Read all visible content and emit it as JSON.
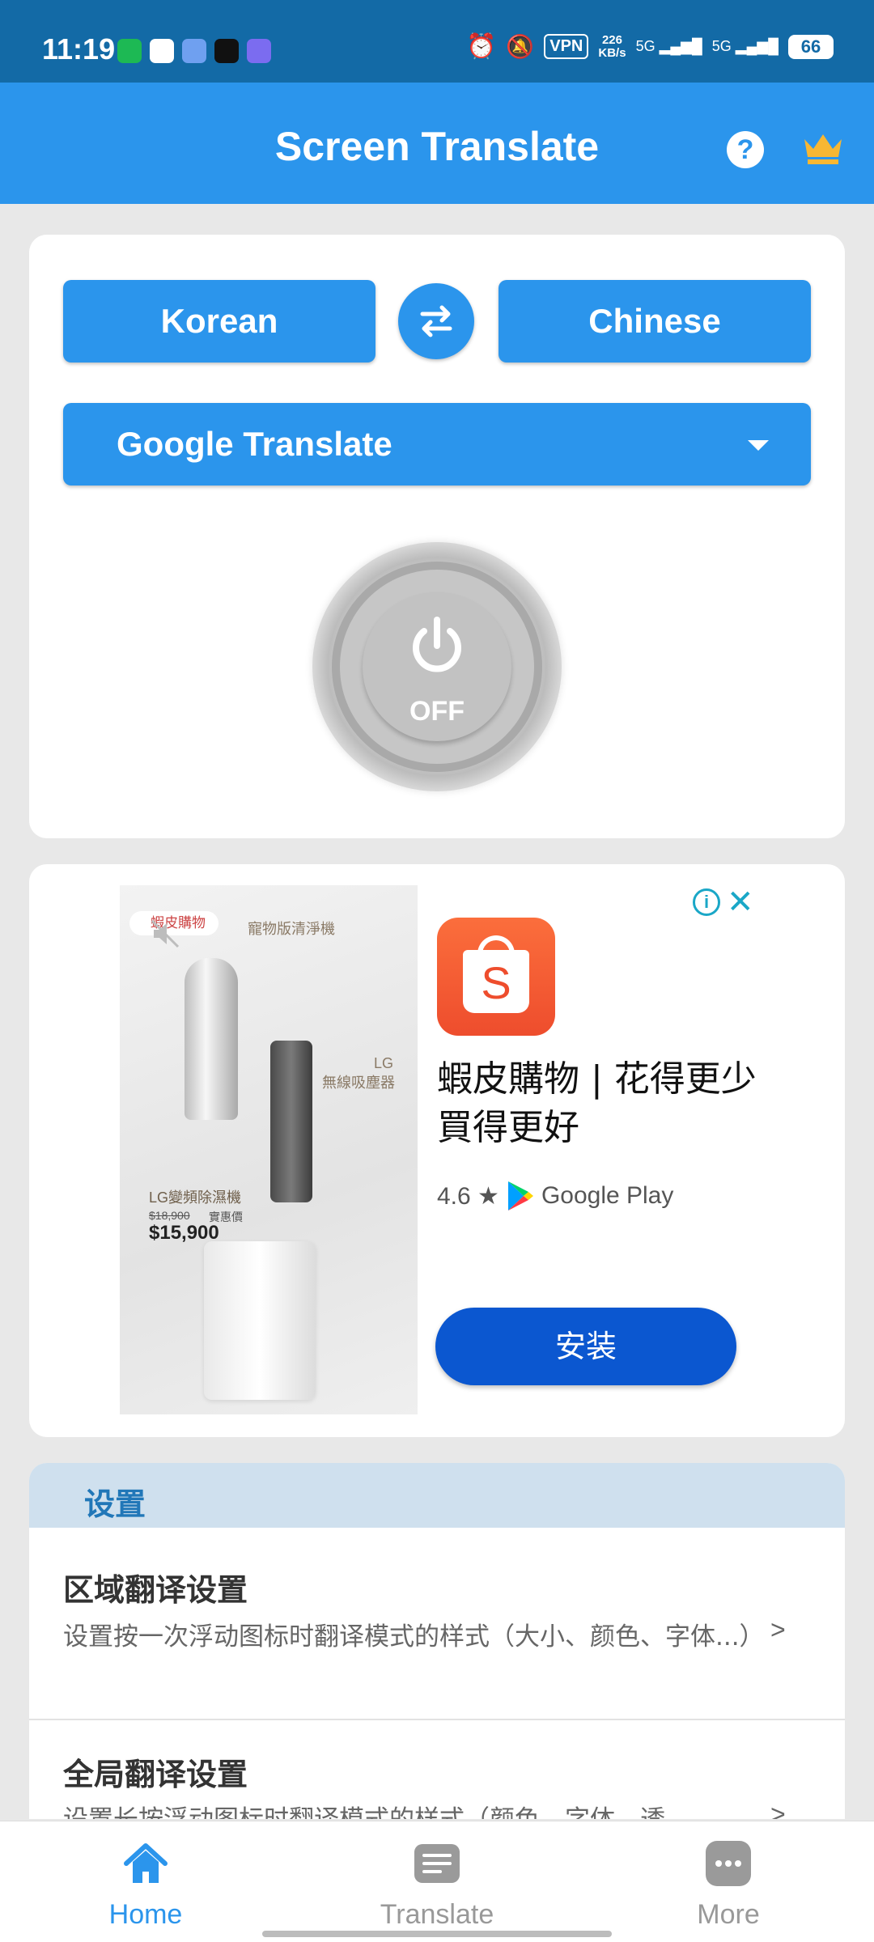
{
  "status_bar": {
    "time": "11:19",
    "vpn": "VPN",
    "net_speed_value": "226",
    "net_speed_unit": "KB/s",
    "signal_1": "5G",
    "signal_2": "5G",
    "battery": "66"
  },
  "app_bar": {
    "title": "Screen Translate",
    "help_glyph": "?"
  },
  "translator": {
    "source_language": "Korean",
    "target_language": "Chinese",
    "engine": "Google Translate",
    "power_state": "OFF"
  },
  "ad": {
    "image_badge": "蝦皮購物",
    "image_text_1": "寵物版清淨機",
    "image_text_2": "LG",
    "image_text_3": "無線吸塵器",
    "image_text_4": "LG變頻除濕機",
    "image_price_old": "$18,900",
    "image_price_label": "實惠價",
    "image_price": "$15,900",
    "logo_letter": "S",
    "title": "蝦皮購物 | 花得更少買得更好",
    "rating": "4.6 ★",
    "store_name": "Google Play",
    "install_label": "安装",
    "info_glyph": "i",
    "close_glyph": "✕"
  },
  "settings": {
    "header": "设置",
    "items": [
      {
        "title": "区域翻译设置",
        "description": "设置按一次浮动图标时翻译模式的样式（大小、颜色、字体...）",
        "chevron": ">"
      },
      {
        "title": "全局翻译设置",
        "description": "设置长按浮动图标时翻译模式的样式（颜色、字体、透",
        "chevron": ">"
      }
    ]
  },
  "bottom_nav": {
    "items": [
      {
        "label": "Home",
        "icon": "home-icon",
        "active": true
      },
      {
        "label": "Translate",
        "icon": "list-icon",
        "active": false
      },
      {
        "label": "More",
        "icon": "more-icon",
        "active": false
      }
    ]
  },
  "colors": {
    "status_bar": "#136aa6",
    "app_bar": "#2b95ec",
    "primary_button": "#2b95ec",
    "install_button": "#0b57d0",
    "nav_active": "#2b95ec",
    "nav_inactive": "#999999"
  }
}
